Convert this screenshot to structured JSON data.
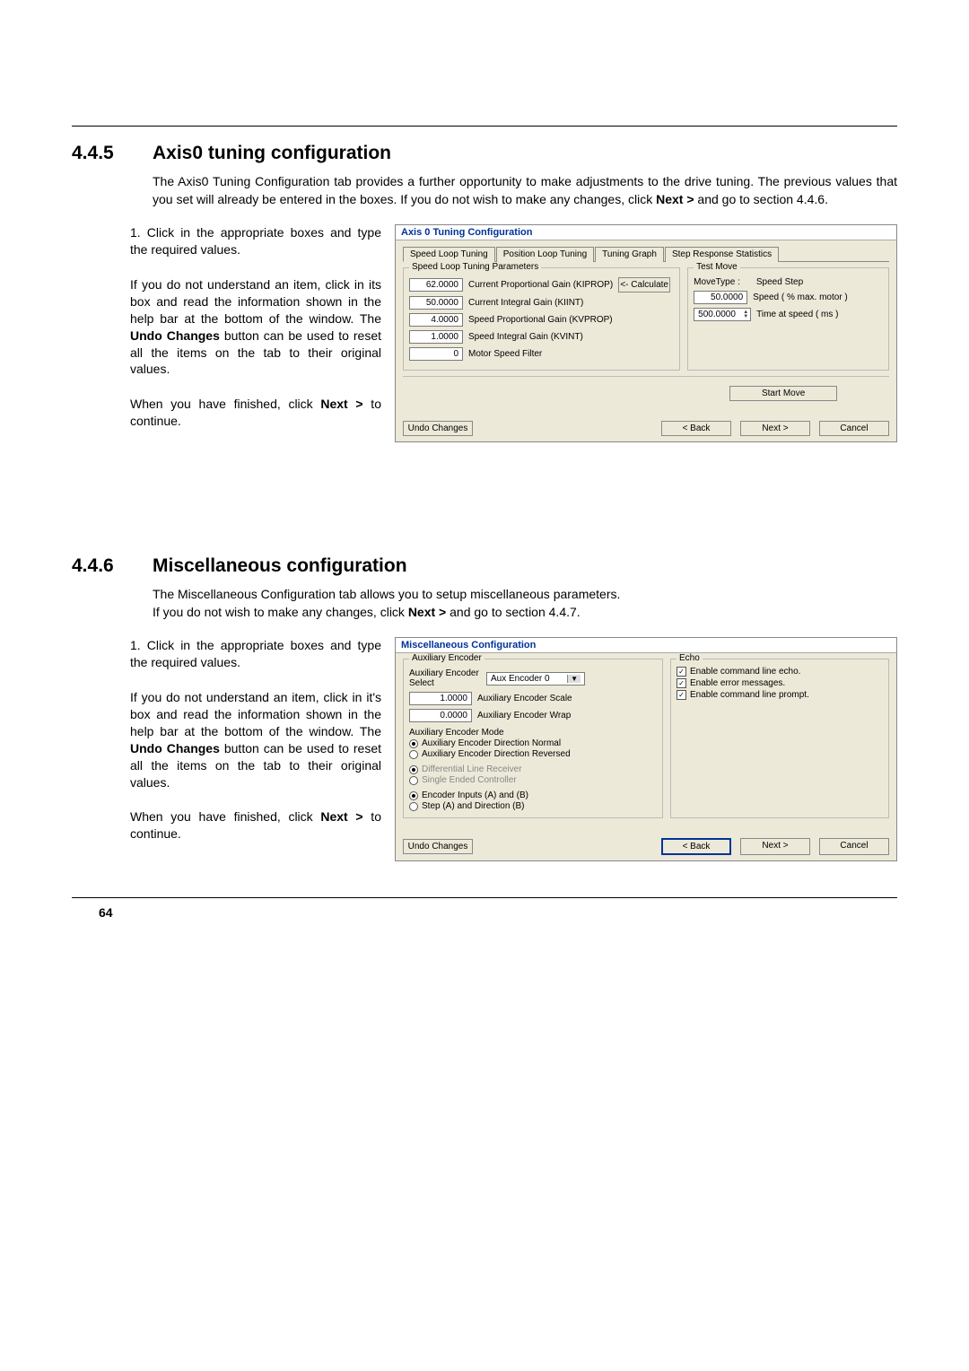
{
  "section445": {
    "num": "4.4.5",
    "title": "Axis0 tuning configuration",
    "intro": "The Axis0 Tuning Configuration tab provides a further opportunity to make adjustments to the drive tuning. The previous values that you set will already be entered in the boxes. If you do not wish to make any changes, click ",
    "intro_bold": "Next >",
    "intro_tail": " and go to section 4.4.6.",
    "step1_num": "1.",
    "step1_a": "Click in the appropriate boxes and type the required values.",
    "step1_b_pre": "If you do not understand an item, click in its box and read the information shown in the help bar at the bottom of the window. The ",
    "step1_b_bold": "Undo Changes",
    "step1_b_post": " button can be used to reset all the items on the tab to their original values.",
    "step1_c_pre": "When you have finished, click ",
    "step1_c_bold": "Next >",
    "step1_c_post": " to continue."
  },
  "dlg1": {
    "title": "Axis 0 Tuning Configuration",
    "tabs": {
      "t1": "Speed Loop Tuning",
      "t2": "Position Loop Tuning",
      "t3": "Tuning Graph",
      "t4": "Step Response Statistics"
    },
    "fs1_legend": "Speed Loop Tuning Parameters",
    "fs2_legend": "Test Move",
    "v_kiprop": "62.0000",
    "l_kiprop": "Current Proportional Gain (KIPROP)",
    "calc": "<- Calculate",
    "v_kiint": "50.0000",
    "l_kiint": "Current Integral Gain (KIINT)",
    "v_kvprop": "4.0000",
    "l_kvprop": "Speed Proportional Gain (KVPROP)",
    "v_kvint": "1.0000",
    "l_kvint": "Speed Integral Gain (KVINT)",
    "v_msf": "0",
    "l_msf": "Motor Speed Filter",
    "movetype_l": "MoveType :",
    "movetype_v": "Speed Step",
    "v_spd": "50.0000",
    "l_spd": "Speed ( % max. motor )",
    "v_time": "500.0000",
    "l_time": "Time at speed ( ms )",
    "start": "Start Move",
    "undo": "Undo Changes",
    "back": "< Back",
    "next": "Next >",
    "cancel": "Cancel"
  },
  "section446": {
    "num": "4.4.6",
    "title": "Miscellaneous configuration",
    "intro_line1": "The Miscellaneous Configuration tab allows you to setup miscellaneous parameters.",
    "intro_line2_pre": "If you do not wish to make any changes, click ",
    "intro_line2_bold": "Next >",
    "intro_line2_post": " and go to section 4.4.7.",
    "step1_num": "1.",
    "step1_a": "Click in the appropriate boxes and type the required values.",
    "step1_b_pre": "If you do not understand an item, click in it's box and read the information shown in the help bar at the bottom of the window. The ",
    "step1_b_bold": "Undo Changes",
    "step1_b_post": " button can be used to reset all the items on the tab to their original values.",
    "step1_c_pre": "When you have finished, click ",
    "step1_c_bold": "Next >",
    "step1_c_post": " to continue."
  },
  "dlg2": {
    "title": "Miscellaneous Configuration",
    "fs1_legend": "Auxiliary Encoder",
    "fs2_legend": "Echo",
    "aux_sel_l": "Auxiliary Encoder Select",
    "aux_sel_v": "Aux Encoder 0",
    "v_scale": "1.0000",
    "l_scale": "Auxiliary Encoder Scale",
    "v_wrap": "0.0000",
    "l_wrap": "Auxiliary Encoder Wrap",
    "mode_legend": "Auxiliary Encoder Mode",
    "r1": "Auxiliary Encoder Direction Normal",
    "r2": "Auxiliary Encoder Direction Reversed",
    "r3": "Differential Line Receiver",
    "r4": "Single Ended Controller",
    "r5": "Encoder Inputs (A) and (B)",
    "r6": "Step (A) and Direction (B)",
    "c1": "Enable command line echo.",
    "c2": "Enable error messages.",
    "c3": "Enable command line prompt.",
    "undo": "Undo Changes",
    "back": "< Back",
    "next": "Next >",
    "cancel": "Cancel"
  },
  "page_num": "64"
}
